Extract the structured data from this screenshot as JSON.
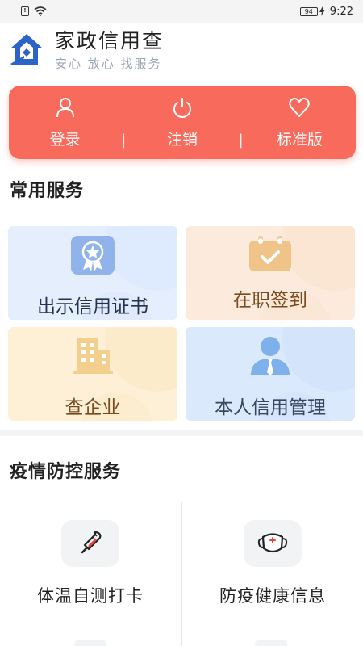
{
  "status_bar": {
    "battery": "94",
    "time": "9:22"
  },
  "header": {
    "title": "家政信用查",
    "slogan": "安心 放心 找服务"
  },
  "auth": {
    "login": "登录",
    "logout": "注销",
    "standard": "标准版",
    "separator": "|"
  },
  "common_services": {
    "title": "常用服务",
    "tiles": [
      {
        "label": "出示信用证书",
        "color": "#23324f"
      },
      {
        "label": "在职签到",
        "color": "#7a4a1e"
      },
      {
        "label": "查企业",
        "color": "#7a4a1e"
      },
      {
        "label": "本人信用管理",
        "color": "#3a4660"
      }
    ]
  },
  "epidemic": {
    "title": "疫情防控服务",
    "items": [
      {
        "label": "体温自测打卡",
        "icon": "thermometer-icon"
      },
      {
        "label": "防疫健康信息",
        "icon": "mask-icon"
      }
    ]
  },
  "colors": {
    "accent_red": "#f76a5c",
    "slogan_gray": "#9aa3b2"
  }
}
